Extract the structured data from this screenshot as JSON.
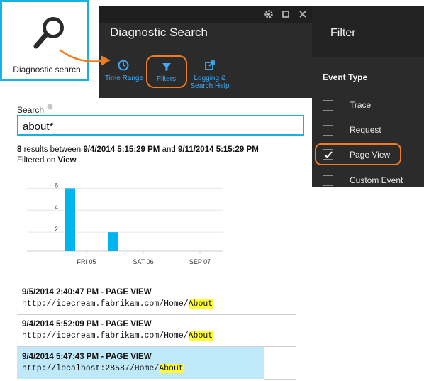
{
  "tile": {
    "label": "Diagnostic search",
    "icon": "magnifier-icon"
  },
  "panel": {
    "title": "Diagnostic Search",
    "toolbar": [
      {
        "label": "Time Range",
        "icon": "clock-icon"
      },
      {
        "label": "Filters",
        "icon": "filter-icon"
      },
      {
        "label_line1": "Logging &",
        "label_line2": "Search Help",
        "icon": "external-link-icon"
      }
    ],
    "window_icons": [
      "gear-icon",
      "maximize-icon",
      "close-icon"
    ]
  },
  "filter": {
    "title": "Filter",
    "section": "Event Type",
    "options": [
      {
        "label": "Trace",
        "checked": false
      },
      {
        "label": "Request",
        "checked": false
      },
      {
        "label": "Page View",
        "checked": true
      },
      {
        "label": "Custom Event",
        "checked": false
      }
    ]
  },
  "search": {
    "label": "Search",
    "value": "about*"
  },
  "summary": {
    "count": "8",
    "between_text": " results between ",
    "from": "9/4/2014 5:15:29 PM",
    "and_text": " and ",
    "to": "9/11/2014 5:15:29 PM",
    "filtered_prefix": "Filtered on ",
    "filtered_value": "View"
  },
  "chart_data": {
    "type": "bar",
    "y_ticks": [
      "6",
      "4",
      "2"
    ],
    "x_ticks": [
      "FRI 05",
      "SAT 06",
      "SEP 07"
    ],
    "bars": [
      {
        "value": 6
      },
      {
        "value": 2
      }
    ],
    "ylim": [
      0,
      7
    ],
    "color": "#00b4f0"
  },
  "results": [
    {
      "title": "9/5/2014 2:40:47 PM - PAGE VIEW",
      "url_prefix": "http://icecream.fabrikam.com/Home/",
      "url_highlight": "About"
    },
    {
      "title": "9/4/2014 5:52:09 PM - PAGE VIEW",
      "url_prefix": "http://icecream.fabrikam.com/Home/",
      "url_highlight": "About"
    },
    {
      "title": "9/4/2014 5:47:43 PM - PAGE VIEW",
      "url_prefix": "http://localhost:28587/Home/",
      "url_highlight": "About"
    }
  ],
  "colors": {
    "accent": "#19b1e3",
    "callout": "#f07c1f",
    "selected_row": "#bfe9f8"
  }
}
